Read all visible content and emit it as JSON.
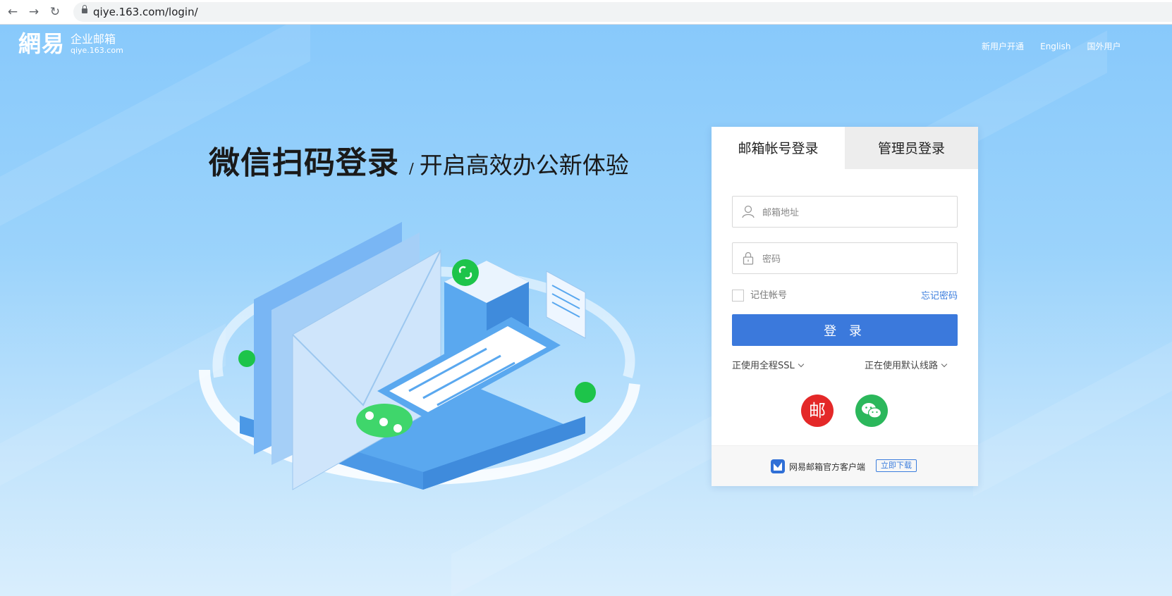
{
  "browser": {
    "url": "qiye.163.com/login/",
    "back_glyph": "←",
    "forward_glyph": "→",
    "reload_glyph": "↻"
  },
  "header": {
    "logo_mark": "網易",
    "logo_title": "企业邮箱",
    "logo_domain": "qiye.163.com",
    "links": [
      "新用户开通",
      "English",
      "国外用户"
    ]
  },
  "hero": {
    "title": "微信扫码登录",
    "separator": "/",
    "subtitle": "开启高效办公新体验"
  },
  "login": {
    "tabs": [
      "邮箱帐号登录",
      "管理员登录"
    ],
    "email_placeholder": "邮箱地址",
    "password_placeholder": "密码",
    "remember_label": "记住帐号",
    "forgot_label": "忘记密码",
    "submit_label": "登 录",
    "ssl_option": "正使用全程SSL",
    "line_option": "正在使用默认线路",
    "mail_glyph": "邮",
    "client_text": "网易邮箱官方客户端",
    "download_label": "立即下载"
  },
  "colors": {
    "primary": "#3b79dc",
    "mail_red": "#e42828",
    "wechat_green": "#2bb75b",
    "sky_blue": "#88c9fb"
  }
}
